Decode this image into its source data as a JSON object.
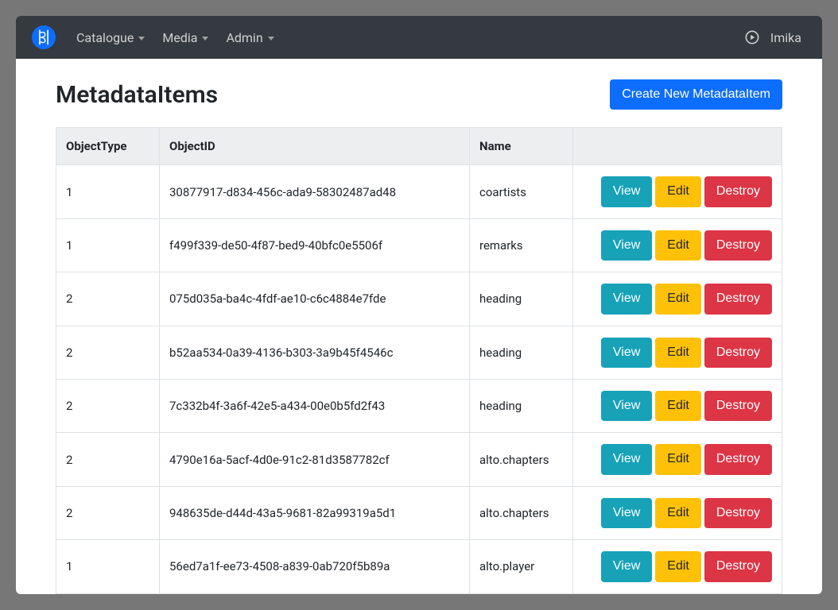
{
  "nav": {
    "items": [
      "Catalogue",
      "Media",
      "Admin"
    ],
    "user": "Imika"
  },
  "page": {
    "title": "MetadataItems",
    "create_label": "Create New MetadataItem"
  },
  "table": {
    "headers": {
      "object_type": "ObjectType",
      "object_id": "ObjectID",
      "name": "Name"
    },
    "action_labels": {
      "view": "View",
      "edit": "Edit",
      "destroy": "Destroy"
    },
    "rows": [
      {
        "object_type": "1",
        "object_id": "30877917-d834-456c-ada9-58302487ad48",
        "name": "coartists"
      },
      {
        "object_type": "1",
        "object_id": "f499f339-de50-4f87-bed9-40bfc0e5506f",
        "name": "remarks"
      },
      {
        "object_type": "2",
        "object_id": "075d035a-ba4c-4fdf-ae10-c6c4884e7fde",
        "name": "heading"
      },
      {
        "object_type": "2",
        "object_id": "b52aa534-0a39-4136-b303-3a9b45f4546c",
        "name": "heading"
      },
      {
        "object_type": "2",
        "object_id": "7c332b4f-3a6f-42e5-a434-00e0b5fd2f43",
        "name": "heading"
      },
      {
        "object_type": "2",
        "object_id": "4790e16a-5acf-4d0e-91c2-81d3587782cf",
        "name": "alto.chapters"
      },
      {
        "object_type": "2",
        "object_id": "948635de-d44d-43a5-9681-82a99319a5d1",
        "name": "alto.chapters"
      },
      {
        "object_type": "1",
        "object_id": "56ed7a1f-ee73-4508-a839-0ab720f5b89a",
        "name": "alto.player"
      }
    ]
  }
}
